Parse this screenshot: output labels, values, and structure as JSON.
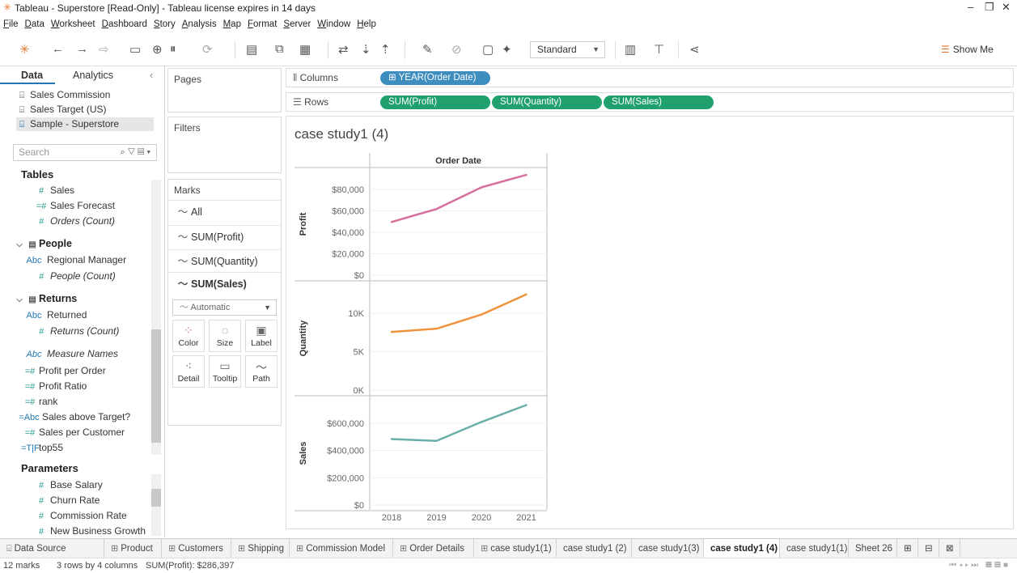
{
  "window": {
    "title": "Tableau - Superstore [Read-Only] - Tableau license expires in 14 days"
  },
  "menu": [
    "File",
    "Data",
    "Worksheet",
    "Dashboard",
    "Story",
    "Analysis",
    "Map",
    "Format",
    "Server",
    "Window",
    "Help"
  ],
  "toolbar": {
    "fit": "Standard",
    "show_me": "Show Me"
  },
  "data_pane": {
    "tabs": {
      "data": "Data",
      "analytics": "Analytics"
    },
    "sources": [
      "Sales Commission",
      "Sales Target (US)",
      "Sample - Superstore"
    ],
    "search_placeholder": "Search",
    "tables_heading": "Tables",
    "fields": [
      "Sales",
      "Sales Forecast",
      "Orders (Count)"
    ],
    "people": {
      "name": "People",
      "fields": [
        "Regional Manager",
        "People (Count)"
      ]
    },
    "returns": {
      "name": "Returns",
      "fields": [
        "Returned",
        "Returns (Count)"
      ]
    },
    "calc_fields": [
      "Measure Names",
      "Profit per Order",
      "Profit Ratio",
      "rank",
      "Sales above Target?",
      "Sales per Customer",
      "top55"
    ],
    "parameters_heading": "Parameters",
    "parameters": [
      "Base Salary",
      "Churn Rate",
      "Commission Rate",
      "New Business Growth"
    ]
  },
  "cards": {
    "pages": "Pages",
    "filters": "Filters",
    "marks": "Marks"
  },
  "marks": {
    "rows": [
      "All",
      "SUM(Profit)",
      "SUM(Quantity)",
      "SUM(Sales)"
    ],
    "type": "Automatic",
    "buttons": [
      "Color",
      "Size",
      "Label",
      "Detail",
      "Tooltip",
      "Path"
    ]
  },
  "shelves": {
    "columns_label": "Columns",
    "rows_label": "Rows",
    "columns": [
      "YEAR(Order Date)"
    ],
    "rows": [
      "SUM(Profit)",
      "SUM(Quantity)",
      "SUM(Sales)"
    ]
  },
  "sheet_title": "case study1 (4)",
  "chart_data": {
    "type": "line",
    "column_header": "Order Date",
    "categories": [
      "2018",
      "2019",
      "2020",
      "2021"
    ],
    "panes": [
      {
        "label": "Profit",
        "color": "#d66f9c",
        "ticks": [
          "$80,000",
          "$60,000",
          "$40,000",
          "$20,000",
          "$0"
        ],
        "tick_values": [
          80000,
          60000,
          40000,
          20000,
          0
        ],
        "ylim": [
          0,
          95000
        ],
        "values": [
          49544,
          61619,
          81795,
          93439
        ]
      },
      {
        "label": "Quantity",
        "color": "#ef933c",
        "ticks": [
          "10K",
          "5K",
          "0K"
        ],
        "tick_values": [
          10000,
          5000,
          0
        ],
        "ylim": [
          0,
          13500
        ],
        "values": [
          7581,
          8000,
          9837,
          12476
        ]
      },
      {
        "label": "Sales",
        "color": "#6aaea9",
        "ticks": [
          "$600,000",
          "$400,000",
          "$200,000",
          "$0"
        ],
        "tick_values": [
          600000,
          400000,
          200000,
          0
        ],
        "ylim": [
          0,
          760000
        ],
        "values": [
          484247,
          470533,
          609206,
          733215
        ]
      }
    ]
  },
  "sheet_tabs": [
    "Data Source",
    "Product",
    "Customers",
    "Shipping",
    "Commission Model",
    "Order Details",
    "case study1(1)",
    "case study1 (2)",
    "case study1(3)",
    "case study1 (4)",
    "case study1(1)",
    "Sheet 26"
  ],
  "active_tab": "case study1 (4)",
  "status": {
    "marks": "12 marks",
    "dims": "3 rows by 4 columns",
    "sum": "SUM(Profit): $286,397"
  }
}
